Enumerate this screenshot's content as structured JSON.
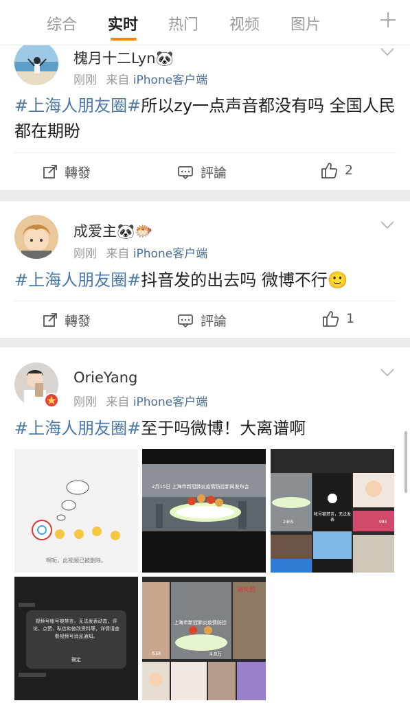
{
  "tabs": [
    {
      "label": "综合"
    },
    {
      "label": "实时"
    },
    {
      "label": "热门"
    },
    {
      "label": "视频"
    },
    {
      "label": "图片"
    }
  ],
  "active_tab": "实时",
  "accent_color": "#ff8200",
  "topic_color": "#4b78a6",
  "posts": [
    {
      "username": "槐月十二Lyn🐼",
      "time": "刚刚",
      "source_prefix": "来自",
      "source": "iPhone客户端",
      "topic": "#上海人朋友圈#",
      "text": "所以zy一点声音都没有吗 全国人民都在期盼",
      "repost_label": "轉發",
      "comment_label": "評論",
      "like_count": "2"
    },
    {
      "username": "成爱主🐼🐡",
      "time": "刚刚",
      "source_prefix": "来自",
      "source": "iPhone客户端",
      "topic": "#上海人朋友圈#",
      "text": "抖音发的出去吗 微博不行🙂",
      "repost_label": "轉發",
      "comment_label": "評論",
      "like_count": "1"
    },
    {
      "username": "OrieYang",
      "time": "刚刚",
      "source_prefix": "来自",
      "source": "iPhone客户端",
      "topic": "#上海人朋友圈#",
      "text": "至于吗微博！大离谱啊",
      "images": [
        {
          "caption": "啊呃，此视频已被删除。"
        },
        {
          "caption": "2月15日 上海市新冠肺炎疫情防控新闻发布会"
        },
        {
          "caption": "帐号被禁言，无法发表",
          "count1": "2465",
          "count2": "984"
        },
        {
          "caption": "视频号帐号被禁言，无法发表动态、评论、点赞、私信和修改资料等，详情请查看视频号消息通知。",
          "confirm": "确定"
        },
        {
          "caption": "上海市新冠肺炎疫情防控",
          "count1": "638",
          "count2": "4.8万",
          "side": "消失的"
        }
      ]
    }
  ]
}
